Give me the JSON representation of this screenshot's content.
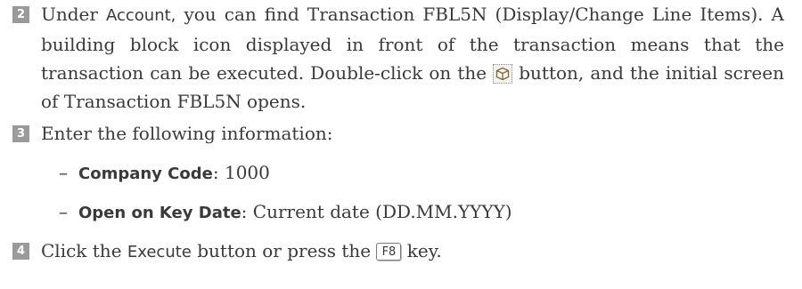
{
  "steps": [
    {
      "number": "2",
      "t1": "Under ",
      "account": "Account,",
      "t2": " you can find Transaction FBL5N (Display/Change Line Items). A building block icon displayed in front of the transaction means that the transaction can be executed. Double-click on the ",
      "icon": "building-block-icon",
      "t3": " button, and the initial screen of Transaction FBL5N opens."
    },
    {
      "number": "3",
      "text": "Enter the following information:",
      "items": [
        {
          "dash": "–",
          "label": "Company Code",
          "sep": ": ",
          "value": "1000"
        },
        {
          "dash": "–",
          "label": "Open on Key Date",
          "sep": ": ",
          "value": "Current date (DD.MM.YYYY)"
        }
      ]
    },
    {
      "number": "4",
      "t1": "Click the ",
      "execute": "Execute",
      "t2": " button or press the ",
      "key": "F8",
      "t3": " key."
    }
  ]
}
